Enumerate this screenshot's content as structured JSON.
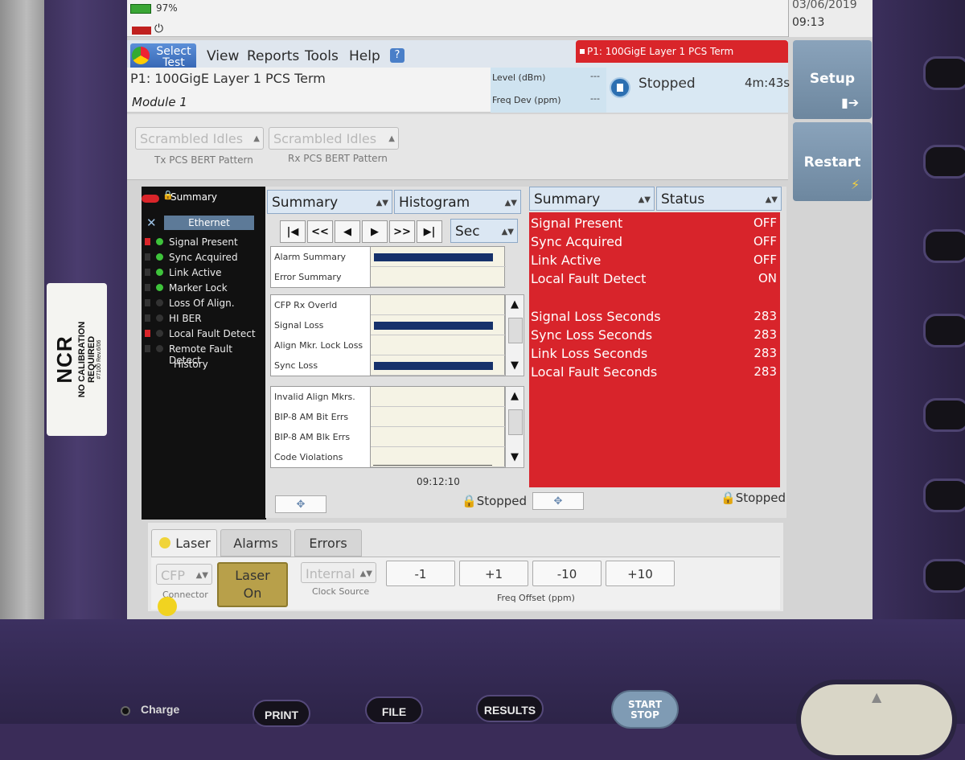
{
  "label": {
    "brand": "NCR",
    "line1": "NO CALIBRATION",
    "line2": "REQUIRED",
    "code": "#7100 Rev.6/06"
  },
  "status_bar": {
    "battery": "97%",
    "date": "03/06/2019",
    "time": "09:13"
  },
  "menu": {
    "select_test": "Select Test",
    "items": [
      "View",
      "Reports",
      "Tools",
      "Help"
    ],
    "help_icon": "?"
  },
  "port_tab": "P1: 100GigE Layer 1 PCS Term",
  "test": {
    "name": "P1: 100GigE Layer 1 PCS Term",
    "module": "Module 1",
    "level_label": "Level (dBm)",
    "level_value": "---",
    "freq_label": "Freq Dev (ppm)",
    "freq_value": "---",
    "state": "Stopped",
    "elapsed": "4m:43s"
  },
  "patterns": {
    "tx_value": "Scrambled Idles",
    "tx_caption": "Tx PCS BERT Pattern",
    "rx_value": "Scrambled Idles",
    "rx_caption": "Rx PCS BERT Pattern"
  },
  "side_buttons": {
    "setup": "Setup",
    "restart": "Restart"
  },
  "tree": {
    "summary": "Summary",
    "ethernet": "Ethernet",
    "items": [
      {
        "label": "Signal Present",
        "dot": "#3ec33b",
        "flag": "#d9252a"
      },
      {
        "label": "Sync Acquired",
        "dot": "#3ec33b",
        "flag": "#333333"
      },
      {
        "label": "Link Active",
        "dot": "#3ec33b",
        "flag": "#333333"
      },
      {
        "label": "Marker Lock",
        "dot": "#3ec33b",
        "flag": "#333333"
      },
      {
        "label": "Loss Of Align.",
        "dot": "#333333",
        "flag": "#333333"
      },
      {
        "label": "HI BER",
        "dot": "#333333",
        "flag": "#333333"
      },
      {
        "label": "Local Fault Detect",
        "dot": "#333333",
        "flag": "#d9252a"
      },
      {
        "label": "Remote Fault Detect",
        "dot": "#333333",
        "flag": "#333333"
      }
    ],
    "history": "History"
  },
  "histogram": {
    "dd_left": "Summary",
    "dd_right": "Histogram",
    "nav": [
      "|◀",
      "<<",
      "◀",
      "▶",
      ">>",
      "▶|"
    ],
    "unit": "Sec",
    "group1": [
      {
        "label": "Alarm Summary",
        "bar": true
      },
      {
        "label": "Error Summary",
        "bar": false
      }
    ],
    "group2": [
      {
        "label": "CFP Rx Overld",
        "bar": false
      },
      {
        "label": "Signal Loss",
        "bar": true
      },
      {
        "label": "Align Mkr. Lock Loss",
        "bar": false
      },
      {
        "label": "Sync Loss",
        "bar": true
      }
    ],
    "group3": [
      {
        "label": "Invalid Align Mkrs.",
        "bar": false
      },
      {
        "label": "BIP-8 AM Bit Errs",
        "bar": false
      },
      {
        "label": "BIP-8 AM Blk Errs",
        "bar": false
      },
      {
        "label": "Code Violations",
        "bar": false
      }
    ],
    "axis_time": "09:12:10",
    "state": "Stopped"
  },
  "status": {
    "dd_left": "Summary",
    "dd_right": "Status",
    "rows1": [
      {
        "k": "Signal Present",
        "v": "OFF"
      },
      {
        "k": "Sync Acquired",
        "v": "OFF"
      },
      {
        "k": "Link Active",
        "v": "OFF"
      },
      {
        "k": "Local Fault Detect",
        "v": "ON"
      }
    ],
    "rows2": [
      {
        "k": "Signal Loss Seconds",
        "v": "283"
      },
      {
        "k": "Sync Loss Seconds",
        "v": "283"
      },
      {
        "k": "Link Loss Seconds",
        "v": "283"
      },
      {
        "k": "Local Fault Seconds",
        "v": "283"
      }
    ],
    "state": "Stopped"
  },
  "actions": {
    "tabs": [
      "Laser",
      "Alarms",
      "Errors"
    ],
    "connector_value": "CFP",
    "connector_caption": "Connector",
    "laser_line1": "Laser",
    "laser_line2": "On",
    "clock_value": "Internal",
    "clock_caption": "Clock Source",
    "freq_buttons": [
      "-1",
      "+1",
      "-10",
      "+10"
    ],
    "freq_caption": "Freq Offset (ppm)"
  },
  "hardware": {
    "charge": "Charge",
    "print": "PRINT",
    "file": "FILE",
    "results": "RESULTS",
    "start_stop_1": "START",
    "start_stop_2": "STOP"
  }
}
